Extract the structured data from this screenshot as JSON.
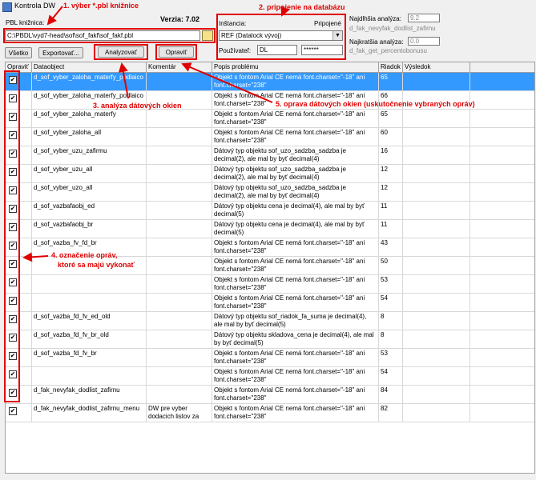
{
  "window": {
    "title": "Kontrola DW"
  },
  "version": "Verzia: 7.02",
  "pbl": {
    "label": "PBL knižnica:",
    "path": "C:\\PBDL\\vyd7-head\\sof\\sof_fakf\\sof_fakf.pbl"
  },
  "instance": {
    "label": "Inštancia:",
    "status": "Pripojené",
    "value": "REF (Datalock vývoj)"
  },
  "user": {
    "label": "Používateľ:",
    "name": "DL",
    "password": "******"
  },
  "slowest": {
    "label": "Najdlhšia analýza:",
    "value": "9.2",
    "object": "d_fak_nevyfak_dodlist_zafirnu"
  },
  "fastest": {
    "label": "Najkratšia analýza:",
    "value": "0.0",
    "object": "d_fak_get_percentobonusu"
  },
  "buttons": {
    "all": "Všetko",
    "export": "Exportovať...",
    "analyze": "Analyzovať",
    "fix": "Opraviť"
  },
  "columns": [
    "Opraviť",
    "Dataobject",
    "Komentár",
    "Popis problému",
    "Riadok",
    "Výsledok"
  ],
  "rows": [
    {
      "dataobject": "d_sof_vyber_zaloha_materfy_podlaico",
      "comment": "",
      "problem": "Objekt s fontom Arial CE nemá font.charset=\"-18\" ani font.charset=\"238\"",
      "line": "65",
      "checked": true,
      "selected": true
    },
    {
      "dataobject": "d_sof_vyber_zaloha_materfy_podlaico",
      "comment": "",
      "problem": "Objekt s fontom Arial CE nemá font.charset=\"-18\" ani font.charset=\"238\"",
      "line": "66",
      "checked": true
    },
    {
      "dataobject": "d_sof_vyber_zaloha_materfy",
      "comment": "",
      "problem": "Objekt s fontom Arial CE nemá font.charset=\"-18\" ani font.charset=\"238\"",
      "line": "65",
      "checked": true
    },
    {
      "dataobject": "d_sof_vyber_zaloha_all",
      "comment": "",
      "problem": "Objekt s fontom Arial CE nemá font.charset=\"-18\" ani font.charset=\"238\"",
      "line": "60",
      "checked": true
    },
    {
      "dataobject": "d_sof_vyber_uzu_zafirmu",
      "comment": "",
      "problem": "Dátový typ objektu sof_uzo_sadzba_sadzba je decimal(2), ale mal by byť decimal(4)",
      "line": "16",
      "checked": true
    },
    {
      "dataobject": "d_sof_vyber_uzu_all",
      "comment": "",
      "problem": "Dátový typ objektu sof_uzo_sadzba_sadzba je decimal(2), ale mal by byť decimal(4)",
      "line": "12",
      "checked": true
    },
    {
      "dataobject": "d_sof_vyber_uzo_all",
      "comment": "",
      "problem": "Dátový typ objektu sof_uzo_sadzba_sadzba je decimal(2), ale mal by byť decimal(4)",
      "line": "12",
      "checked": true
    },
    {
      "dataobject": "d_sof_vazbafaobj_ed",
      "comment": "",
      "problem": "Dátový typ objektu cena je decimal(4), ale mal by byť decimal(5)",
      "line": "11",
      "checked": true
    },
    {
      "dataobject": "d_sof_vazbafaobj_br",
      "comment": "",
      "problem": "Dátový typ objektu cena je decimal(4), ale mal by byť decimal(5)",
      "line": "11",
      "checked": true
    },
    {
      "dataobject": "d_sof_vazba_fv_fd_br",
      "comment": "",
      "problem": "Objekt s fontom Arial CE nemá font.charset=\"-18\" ani font.charset=\"238\"",
      "line": "43",
      "checked": true
    },
    {
      "dataobject": "",
      "comment": "",
      "problem": "Objekt s fontom Arial CE nemá font.charset=\"-18\" ani font.charset=\"238\"",
      "line": "50",
      "checked": true
    },
    {
      "dataobject": "",
      "comment": "",
      "problem": "Objekt s fontom Arial CE nemá font.charset=\"-18\" ani font.charset=\"238\"",
      "line": "53",
      "checked": true
    },
    {
      "dataobject": "",
      "comment": "",
      "problem": "Objekt s fontom Arial CE nemá font.charset=\"-18\" ani font.charset=\"238\"",
      "line": "54",
      "checked": true
    },
    {
      "dataobject": "d_sof_vazba_fd_fv_ed_old",
      "comment": "",
      "problem": "Dátový typ objektu sof_riadok_fa_suma je decimal(4), ale mal by byť decimal(5)",
      "line": "8",
      "checked": true
    },
    {
      "dataobject": "d_sof_vazba_fd_fv_br_old",
      "comment": "",
      "problem": "Dátový typ objektu skladova_cena je decimal(4), ale mal by byť decimal(5)",
      "line": "8",
      "checked": true
    },
    {
      "dataobject": "d_sof_vazba_fd_fv_br",
      "comment": "",
      "problem": "Objekt s fontom Arial CE nemá font.charset=\"-18\" ani font.charset=\"238\"",
      "line": "53",
      "checked": true
    },
    {
      "dataobject": "",
      "comment": "",
      "problem": "Objekt s fontom Arial CE nemá font.charset=\"-18\" ani font.charset=\"238\"",
      "line": "54",
      "checked": true
    },
    {
      "dataobject": "d_fak_nevyfak_dodlist_zafirnu",
      "comment": "",
      "problem": "Objekt s fontom Arial CE nemá font.charset=\"-18\" ani font.charset=\"238\"",
      "line": "84",
      "checked": true
    },
    {
      "dataobject": "d_fak_nevyfak_dodlist_zafirnu_menu",
      "comment": "DW pre vyber dodacich listov za firmu a menu. BV",
      "problem": "Objekt s fontom Arial CE nemá font.charset=\"-18\" ani font.charset=\"238\"",
      "line": "82",
      "checked": true
    }
  ],
  "annotations": {
    "a1": "1. výber *.pbl knižnice",
    "a2": "2. pripojenie na databázu",
    "a3": "3. analýza dátových okien",
    "a4a": "4. označenie opráv,",
    "a4b": "ktoré sa majú vykonať",
    "a5": "5. oprava dátových okien (uskutočnenie vybraných opráv)"
  },
  "colors": {
    "annotation": "#e00000",
    "selection": "#3399ff"
  }
}
